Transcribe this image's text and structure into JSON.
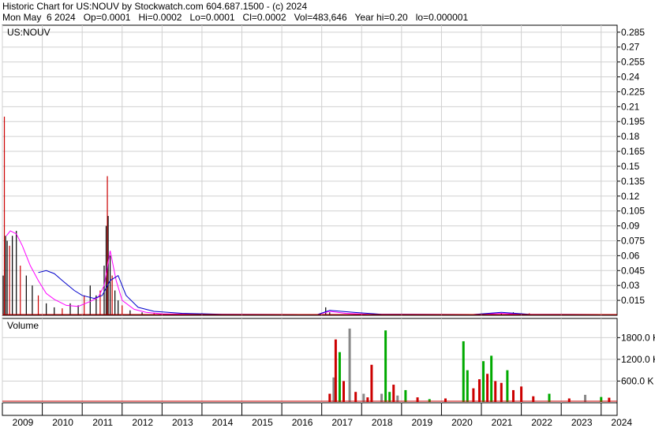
{
  "header": {
    "line1": "Historic Chart for US:NOUV by Stockwatch.com 604.687.1500 - (c) 2024",
    "line2": "Mon May  6 2024   Op=0.0001   Hi=0.0002   Lo=0.0001   Cl=0.0002   Vol=483,646   Year hi=0.20   lo=0.000001"
  },
  "chart_data": [
    {
      "type": "line",
      "title": "US:NOUV",
      "y_ticks": [
        "0.285",
        "0.27",
        "0.255",
        "0.24",
        "0.225",
        "0.21",
        "0.195",
        "0.18",
        "0.165",
        "0.15",
        "0.135",
        "0.12",
        "0.105",
        "0.09",
        "0.075",
        "0.06",
        "0.045",
        "0.03",
        "0.015"
      ],
      "ylim": [
        0,
        0.292
      ],
      "x_ticks": [
        "2009",
        "2010",
        "2011",
        "2012",
        "2013",
        "2014",
        "2015",
        "2016",
        "2017",
        "2018",
        "2019",
        "2020",
        "2021",
        "2022",
        "2023",
        "2024"
      ],
      "xlim": [
        2009.0,
        2024.4
      ],
      "grid": true,
      "colors": {
        "price": "#000000",
        "price_down": "#cc0000",
        "ma_fast": "#ff00ff",
        "ma_slow": "#0000cc"
      },
      "series": [
        {
          "name": "",
          "role": "price",
          "x": [
            2009.02,
            2009.05,
            2009.08,
            2009.12,
            2009.18,
            2009.25,
            2009.35,
            2009.45,
            2009.6,
            2009.75,
            2009.9,
            2010.1,
            2010.3,
            2010.5,
            2010.7,
            2010.9,
            2011.05,
            2011.2,
            2011.35,
            2011.45,
            2011.55,
            2011.6,
            2011.63,
            2011.65,
            2011.7,
            2011.75,
            2011.82,
            2011.9,
            2012.0,
            2012.2,
            2012.5,
            2012.8,
            2013.2,
            2013.8,
            2014.5,
            2015.5,
            2016.5,
            2017.0,
            2017.1,
            2017.2,
            2017.5,
            2018.0,
            2018.6,
            2019.5,
            2020.5,
            2020.9,
            2021.2,
            2021.5,
            2021.8,
            2022.2,
            2022.6,
            2023.2,
            2023.8,
            2024.35
          ],
          "values": [
            0.04,
            0.2,
            0.08,
            0.075,
            0.07,
            0.08,
            0.085,
            0.05,
            0.04,
            0.03,
            0.02,
            0.012,
            0.008,
            0.007,
            0.012,
            0.01,
            0.02,
            0.03,
            0.02,
            0.025,
            0.05,
            0.09,
            0.14,
            0.1,
            0.06,
            0.04,
            0.025,
            0.015,
            0.01,
            0.005,
            0.003,
            0.002,
            0.001,
            0.0008,
            0.0005,
            0.0004,
            0.0003,
            0.0004,
            0.008,
            0.003,
            0.001,
            0.0006,
            0.0004,
            0.0003,
            0.0003,
            0.0005,
            0.001,
            0.002,
            0.003,
            0.002,
            0.001,
            0.0006,
            0.0003,
            0.0002
          ]
        },
        {
          "name": "",
          "role": "ma_fast",
          "x": [
            2009.1,
            2009.2,
            2009.35,
            2009.5,
            2009.7,
            2009.9,
            2010.1,
            2010.3,
            2010.6,
            2010.9,
            2011.2,
            2011.4,
            2011.55,
            2011.7,
            2011.85,
            2012.0,
            2012.3,
            2012.6,
            2013.0,
            2014.0,
            2016.9,
            2017.2,
            2017.6,
            2018.2,
            2020.8,
            2021.5,
            2022.0,
            2024.35
          ],
          "values": [
            0.08,
            0.085,
            0.082,
            0.07,
            0.05,
            0.035,
            0.022,
            0.016,
            0.01,
            0.009,
            0.014,
            0.018,
            0.03,
            0.065,
            0.035,
            0.015,
            0.006,
            0.003,
            0.0015,
            0.001,
            0.0008,
            0.004,
            0.002,
            0.001,
            0.0006,
            0.002,
            0.001,
            0.0003
          ]
        },
        {
          "name": "",
          "role": "ma_slow",
          "x": [
            2009.9,
            2010.1,
            2010.3,
            2010.5,
            2010.8,
            2011.0,
            2011.3,
            2011.5,
            2011.7,
            2011.9,
            2012.1,
            2012.4,
            2012.8,
            2013.5,
            2014.5,
            2016.9,
            2017.2,
            2017.8,
            2018.5,
            2020.8,
            2021.5,
            2022.2,
            2024.35
          ],
          "values": [
            0.043,
            0.045,
            0.042,
            0.035,
            0.025,
            0.02,
            0.017,
            0.02,
            0.035,
            0.04,
            0.02,
            0.008,
            0.004,
            0.002,
            0.001,
            0.0008,
            0.005,
            0.003,
            0.001,
            0.0007,
            0.003,
            0.001,
            0.0004
          ]
        }
      ]
    },
    {
      "type": "bar",
      "title": "Volume",
      "y_ticks": [
        "1800.0",
        "1200.0",
        "600.0"
      ],
      "y_tick_suffix_cut": [
        "K",
        "K",
        "K"
      ],
      "ylim": [
        0,
        2200
      ],
      "colors": {
        "up": "#00aa00",
        "down": "#cc0000",
        "flat": "#888888"
      },
      "series": [
        {
          "name": "",
          "role": "volume",
          "x": [
            2017.2,
            2017.3,
            2017.35,
            2017.45,
            2017.55,
            2017.7,
            2017.85,
            2018.05,
            2018.15,
            2018.25,
            2018.5,
            2018.6,
            2018.7,
            2018.8,
            2018.9,
            2019.1,
            2019.4,
            2019.7,
            2020.1,
            2020.55,
            2020.65,
            2020.8,
            2020.95,
            2021.05,
            2021.15,
            2021.25,
            2021.35,
            2021.5,
            2021.65,
            2021.8,
            2022.0,
            2022.3,
            2022.7,
            2023.2,
            2023.6,
            2024.0,
            2024.2
          ],
          "values": [
            250,
            700,
            1750,
            1400,
            600,
            2050,
            300,
            250,
            150,
            1050,
            250,
            2000,
            300,
            500,
            200,
            350,
            150,
            100,
            120,
            1700,
            900,
            400,
            650,
            1150,
            800,
            1300,
            600,
            550,
            900,
            350,
            450,
            180,
            250,
            120,
            220,
            160,
            140
          ],
          "colors": [
            "down",
            "flat",
            "down",
            "green",
            "down",
            "flat",
            "down",
            "flat",
            "down",
            "down",
            "flat",
            "green",
            "green",
            "down",
            "flat",
            "green",
            "down",
            "green",
            "down",
            "green",
            "green",
            "down",
            "down",
            "green",
            "down",
            "green",
            "down",
            "down",
            "green",
            "down",
            "down",
            "down",
            "green",
            "down",
            "flat",
            "green",
            "down"
          ]
        }
      ]
    }
  ]
}
